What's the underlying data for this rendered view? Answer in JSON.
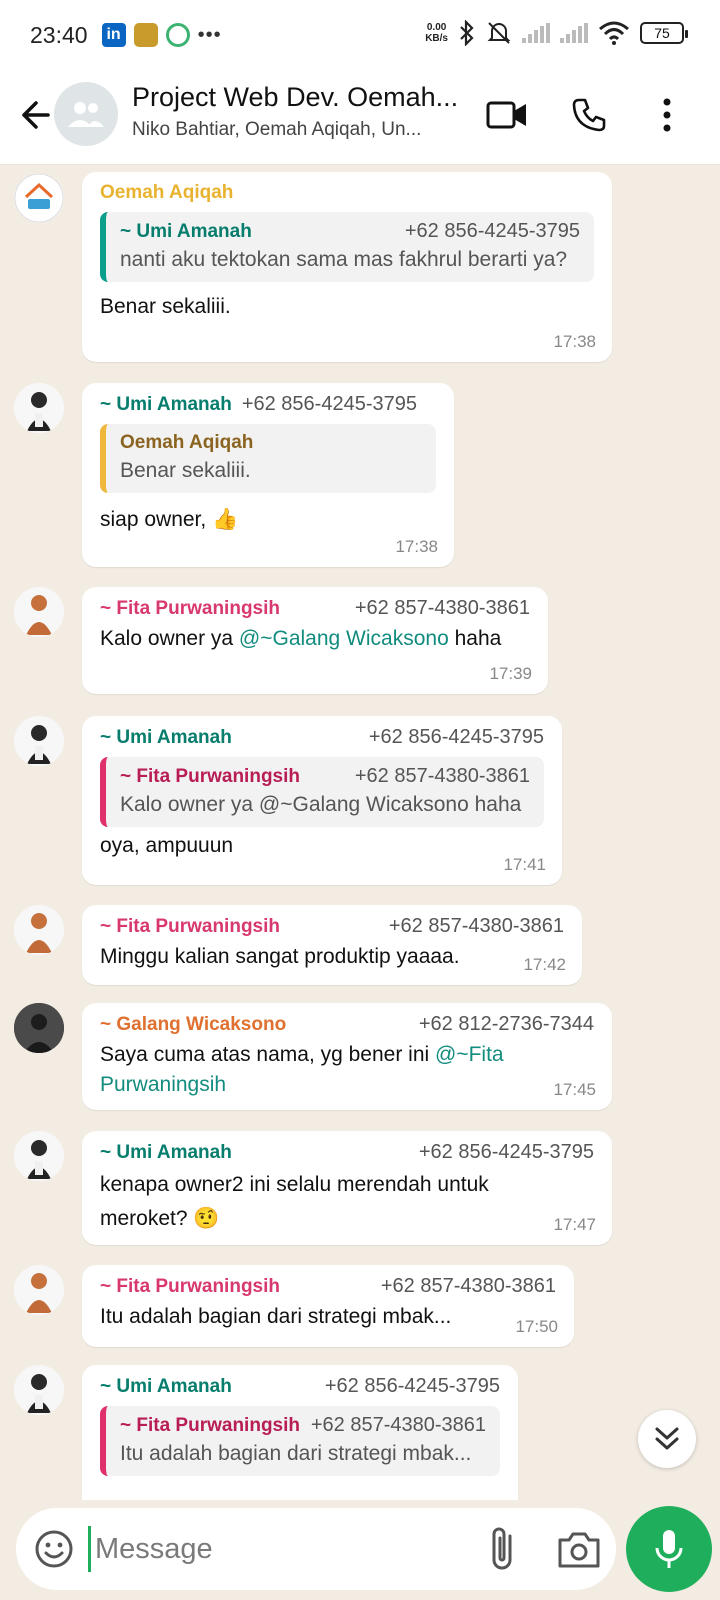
{
  "status_bar": {
    "time": "23:40",
    "linkedin_label": "in",
    "net_speed_value": "0.00",
    "net_speed_unit": "KB/s",
    "battery": "75"
  },
  "header": {
    "title": "Project Web Dev. Oemah...",
    "members": "Niko Bahtiar, Oemah Aqiqah, Un..."
  },
  "messages": [
    {
      "sender": "Oemah Aqiqah",
      "quote": {
        "sender": "~ Umi Amanah",
        "phone": "+62 856-4245-3795",
        "text": "nanti aku tektokan sama mas fakhrul berarti ya?"
      },
      "text": "Benar sekaliii.",
      "time": "17:38"
    },
    {
      "sender": "~ Umi Amanah",
      "phone": "+62 856-4245-3795",
      "quote": {
        "sender": "Oemah Aqiqah",
        "text": "Benar sekaliii."
      },
      "text": "siap owner, 👍",
      "time": "17:38"
    },
    {
      "sender": "~ Fita Purwaningsih",
      "phone": "+62 857-4380-3861",
      "text_before": "Kalo owner ya ",
      "mention": "@~Galang Wicaksono",
      "text_after": " haha",
      "time": "17:39"
    },
    {
      "sender": "~ Umi Amanah",
      "phone": "+62 856-4245-3795",
      "quote": {
        "sender": "~ Fita Purwaningsih",
        "phone": "+62 857-4380-3861",
        "text": "Kalo owner ya @~Galang Wicaksono haha"
      },
      "text": "oya, ampuuun",
      "time": "17:41"
    },
    {
      "sender": "~ Fita Purwaningsih",
      "phone": "+62 857-4380-3861",
      "text": "Minggu kalian sangat produktip yaaaa.",
      "time": "17:42"
    },
    {
      "sender": "~ Galang Wicaksono",
      "phone": "+62 812-2736-7344",
      "text_before": "Saya cuma atas nama, yg bener ini ",
      "mention": "@~Fita Purwaningsih",
      "time": "17:45"
    },
    {
      "sender": "~ Umi Amanah",
      "phone": "+62 856-4245-3795",
      "text": "kenapa owner2 ini selalu merendah untuk meroket? 🤨",
      "time": "17:47"
    },
    {
      "sender": "~ Fita Purwaningsih",
      "phone": "+62 857-4380-3861",
      "text": "Itu adalah bagian dari strategi mbak...",
      "time": "17:50"
    },
    {
      "sender": "~ Umi Amanah",
      "phone": "+62 856-4245-3795",
      "quote": {
        "sender": "~ Fita Purwaningsih",
        "phone": "+62 857-4380-3861",
        "text": "Itu adalah bagian dari strategi mbak..."
      }
    }
  ],
  "avatar_labels": {
    "oemah": "Oemah Aqiqah"
  },
  "input": {
    "placeholder": "Message"
  },
  "colors": {
    "accent_green": "#1fae5b",
    "oemah_name": "#e9b330",
    "umi_name": "#067d6d",
    "fita_name": "#d83870",
    "galang_name": "#e0702f"
  },
  "icons": [
    "back-arrow-icon",
    "group-icon",
    "video-call-icon",
    "phone-call-icon",
    "more-vert-icon",
    "emoji-icon",
    "attach-icon",
    "camera-icon",
    "mic-icon",
    "chevron-double-down-icon",
    "bluetooth-icon",
    "silent-icon",
    "wifi-icon"
  ]
}
